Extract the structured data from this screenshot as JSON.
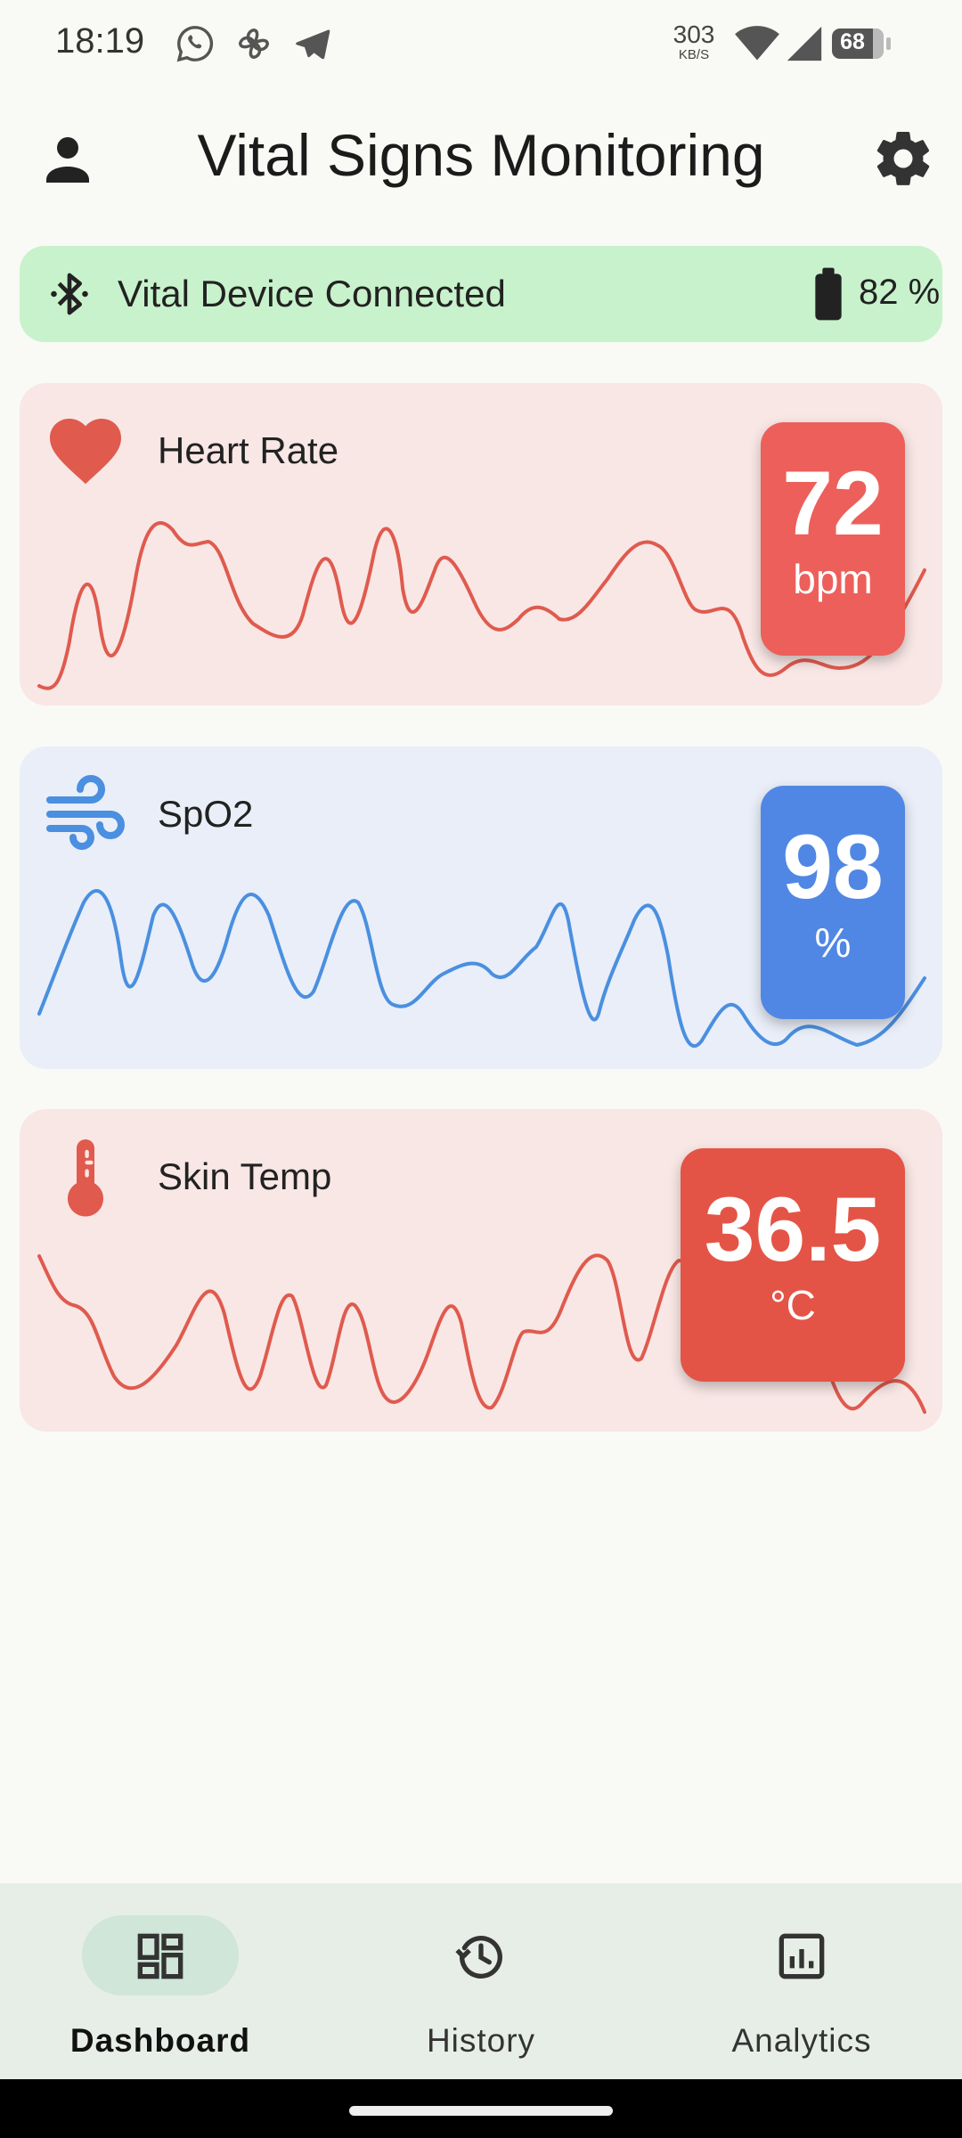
{
  "status_bar": {
    "time": "18:19",
    "net_speed_value": "303",
    "net_speed_unit": "KB/S",
    "battery_level": "68",
    "icons": [
      "whatsapp-icon",
      "pinwheel-icon",
      "telegram-icon",
      "wifi-icon",
      "signal-icon",
      "battery-icon"
    ]
  },
  "app_bar": {
    "title": "Vital Signs Monitoring",
    "left_icon": "person-icon",
    "right_icon": "gear-icon"
  },
  "device": {
    "status": "Vital Device Connected",
    "battery": "82 %",
    "battery_fraction": 0.82
  },
  "vitals": [
    {
      "label": "Heart Rate",
      "value": "72",
      "unit": "bpm",
      "icon": "heart-icon",
      "color": "#e05a4e"
    },
    {
      "label": "SpO2",
      "value": "98",
      "unit": "%",
      "icon": "wind-icon",
      "color": "#4a8fe0"
    },
    {
      "label": "Skin Temp",
      "value": "36.5",
      "unit": "°C",
      "icon": "thermometer-icon",
      "color": "#e05a4e"
    }
  ],
  "nav": {
    "items": [
      {
        "label": "Dashboard",
        "icon": "dashboard-icon",
        "active": true
      },
      {
        "label": "History",
        "icon": "history-icon",
        "active": false
      },
      {
        "label": "Analytics",
        "icon": "analytics-icon",
        "active": false
      }
    ]
  },
  "colors": {
    "background": "#f9faf5",
    "connected_bg": "#c8f2cc",
    "hr_card_bg": "#f8e7e5",
    "spo2_card_bg": "#e9eef8",
    "temp_card_bg": "#f8e7e5",
    "hr_badge": "#ed5f5a",
    "spo2_badge": "#5087e4",
    "temp_badge": "#e45446",
    "nav_bg": "#e7eee7",
    "nav_active_pill": "#cfe6d8"
  }
}
